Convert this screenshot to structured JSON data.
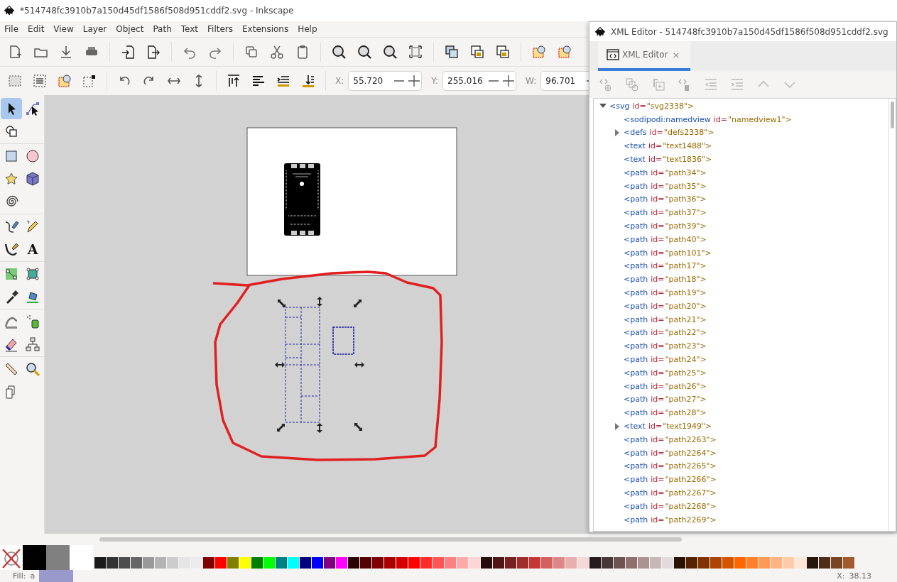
{
  "window": {
    "title": "*514748fc3910b7a150d45df1586f508d951cddf2.svg - Inkscape"
  },
  "menu": [
    "File",
    "Edit",
    "View",
    "Layer",
    "Object",
    "Path",
    "Text",
    "Filters",
    "Extensions",
    "Help"
  ],
  "toolbox": {
    "tools": [
      {
        "selected": true
      },
      {
        "selected": false
      },
      {
        "selected": false
      },
      {
        "selected": false
      },
      {
        "selected": false
      },
      {
        "selected": false
      },
      {
        "selected": false
      },
      {
        "selected": false
      },
      {
        "selected": false
      },
      {
        "selected": false
      },
      {
        "selected": false
      },
      {
        "selected": false,
        "glyph": "A"
      },
      {
        "selected": false
      },
      {
        "selected": false
      },
      {
        "selected": false
      },
      {
        "selected": false
      },
      {
        "selected": false
      },
      {
        "selected": false
      },
      {
        "selected": false
      },
      {
        "selected": false
      },
      {
        "selected": false
      },
      {
        "selected": false
      },
      {
        "selected": false
      }
    ]
  },
  "fields": [
    {
      "label": "X:",
      "value": "55.720"
    },
    {
      "label": "Y:",
      "value": "255.016"
    },
    {
      "label": "W:",
      "value": "96.701"
    }
  ],
  "xml_editor": {
    "title": "XML Editor - 514748fc3910b7a150d45df1586f508d951cddf2.svg",
    "tabs": [
      {
        "label": "XML Editor",
        "selected": true,
        "close": "×"
      }
    ],
    "nodes": [
      {
        "tag": "<svg",
        "attr": "id=",
        "value": "\"svg2338\">",
        "expanded": true,
        "selected": false,
        "children": [
          {
            "tag": "<sodipodi:namedview",
            "attr": "id=",
            "value": "\"namedview1\">",
            "selected": false
          },
          {
            "tag": "<defs",
            "attr": "id=",
            "value": "\"defs2338\">",
            "expanded": false,
            "selected": false
          },
          {
            "tag": "<text",
            "attr": "id=",
            "value": "\"text1488\">",
            "selected": false
          },
          {
            "tag": "<text",
            "attr": "id=",
            "value": "\"text1836\">",
            "selected": false
          },
          {
            "tag": "<path",
            "attr": "id=",
            "value": "\"path34\">",
            "selected": false
          },
          {
            "tag": "<path",
            "attr": "id=",
            "value": "\"path35\">",
            "selected": false
          },
          {
            "tag": "<path",
            "attr": "id=",
            "value": "\"path36\">",
            "selected": false
          },
          {
            "tag": "<path",
            "attr": "id=",
            "value": "\"path37\">",
            "selected": false
          },
          {
            "tag": "<path",
            "attr": "id=",
            "value": "\"path39\">",
            "selected": false
          },
          {
            "tag": "<path",
            "attr": "id=",
            "value": "\"path40\">",
            "selected": false
          },
          {
            "tag": "<path",
            "attr": "id=",
            "value": "\"path101\">",
            "selected": false
          },
          {
            "tag": "<path",
            "attr": "id=",
            "value": "\"path17\">",
            "selected": false
          },
          {
            "tag": "<path",
            "attr": "id=",
            "value": "\"path18\">",
            "selected": false
          },
          {
            "tag": "<path",
            "attr": "id=",
            "value": "\"path19\">",
            "selected": false
          },
          {
            "tag": "<path",
            "attr": "id=",
            "value": "\"path20\">",
            "selected": false
          },
          {
            "tag": "<path",
            "attr": "id=",
            "value": "\"path21\">",
            "selected": false
          },
          {
            "tag": "<path",
            "attr": "id=",
            "value": "\"path22\">",
            "selected": false
          },
          {
            "tag": "<path",
            "attr": "id=",
            "value": "\"path23\">",
            "selected": false
          },
          {
            "tag": "<path",
            "attr": "id=",
            "value": "\"path24\">",
            "selected": false
          },
          {
            "tag": "<path",
            "attr": "id=",
            "value": "\"path25\">",
            "selected": false
          },
          {
            "tag": "<path",
            "attr": "id=",
            "value": "\"path26\">",
            "selected": false
          },
          {
            "tag": "<path",
            "attr": "id=",
            "value": "\"path27\">",
            "selected": false
          },
          {
            "tag": "<path",
            "attr": "id=",
            "value": "\"path28\">",
            "selected": false
          },
          {
            "tag": "<text",
            "attr": "id=",
            "value": "\"text1949\">",
            "expanded": false,
            "selected": false
          },
          {
            "tag": "<path",
            "attr": "id=",
            "value": "\"path2263\">",
            "selected": false
          },
          {
            "tag": "<path",
            "attr": "id=",
            "value": "\"path2264\">",
            "selected": false
          },
          {
            "tag": "<path",
            "attr": "id=",
            "value": "\"path2265\">",
            "selected": false
          },
          {
            "tag": "<path",
            "attr": "id=",
            "value": "\"path2266\">",
            "selected": false
          },
          {
            "tag": "<path",
            "attr": "id=",
            "value": "\"path2267\">",
            "selected": false
          },
          {
            "tag": "<path",
            "attr": "id=",
            "value": "\"path2268\">",
            "selected": false
          },
          {
            "tag": "<path",
            "attr": "id=",
            "value": "\"path2269\">",
            "selected": false
          }
        ]
      }
    ]
  },
  "palette": {
    "main": [
      {
        "color": "#000000"
      },
      {
        "color": "#808080"
      },
      {
        "color": "#ffffff"
      }
    ],
    "swatches": [
      {
        "color": "#1a1a1a"
      },
      {
        "color": "#333333"
      },
      {
        "color": "#4d4d4d"
      },
      {
        "color": "#666666"
      },
      {
        "color": "#999999"
      },
      {
        "color": "#b3b3b3"
      },
      {
        "color": "#cccccc"
      },
      {
        "color": "#e6e6e6"
      },
      {
        "color": "#ececec"
      },
      {
        "color": "#800000"
      },
      {
        "color": "#ff0000"
      },
      {
        "color": "#808000"
      },
      {
        "color": "#ffff00"
      },
      {
        "color": "#008000"
      },
      {
        "color": "#00ff00"
      },
      {
        "color": "#008080"
      },
      {
        "color": "#00ffff"
      },
      {
        "color": "#000080"
      },
      {
        "color": "#0000ff"
      },
      {
        "color": "#800080"
      },
      {
        "color": "#ff00ff"
      },
      {
        "color": "#2b0000"
      },
      {
        "color": "#550000"
      },
      {
        "color": "#800000"
      },
      {
        "color": "#aa0000"
      },
      {
        "color": "#d40000"
      },
      {
        "color": "#ff0000"
      },
      {
        "color": "#ff2a2a"
      },
      {
        "color": "#ff5555"
      },
      {
        "color": "#ff8080"
      },
      {
        "color": "#ffaaaa"
      },
      {
        "color": "#ffd5d5"
      },
      {
        "color": "#280b0b"
      },
      {
        "color": "#501616"
      },
      {
        "color": "#782121"
      },
      {
        "color": "#a02c2c"
      },
      {
        "color": "#c83737"
      },
      {
        "color": "#d35f5f"
      },
      {
        "color": "#de8787"
      },
      {
        "color": "#e9afaf"
      },
      {
        "color": "#f4d7d7"
      },
      {
        "color": "#241c1c"
      },
      {
        "color": "#483737"
      },
      {
        "color": "#6c5353"
      },
      {
        "color": "#916f6f"
      },
      {
        "color": "#ac9393"
      },
      {
        "color": "#c8b7b7"
      },
      {
        "color": "#e3dbdb"
      },
      {
        "color": "#2b1100"
      },
      {
        "color": "#552200"
      },
      {
        "color": "#803300"
      },
      {
        "color": "#aa4400"
      },
      {
        "color": "#d45500"
      },
      {
        "color": "#ff6600"
      },
      {
        "color": "#ff7f2a"
      },
      {
        "color": "#ff9955"
      },
      {
        "color": "#ffb380"
      },
      {
        "color": "#ffccaa"
      },
      {
        "color": "#ffe6d5"
      },
      {
        "color": "#28170b"
      },
      {
        "color": "#502d16"
      },
      {
        "color": "#784421"
      },
      {
        "color": "#a05a2c"
      }
    ]
  },
  "status_bar": {
    "fill_label": "Fill:",
    "fill_value": "a",
    "x_label": "X:",
    "x_value": "38.13"
  }
}
